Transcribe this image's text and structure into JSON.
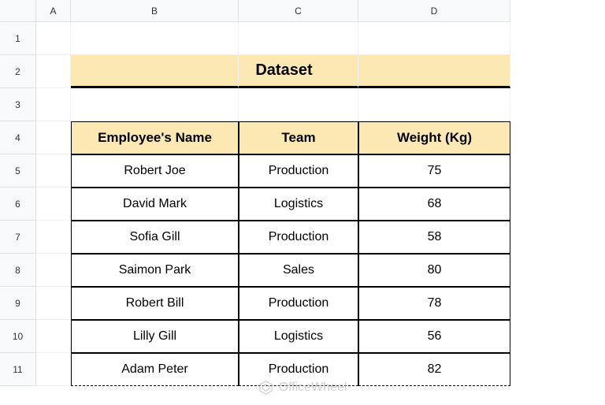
{
  "columns": [
    "A",
    "B",
    "C",
    "D"
  ],
  "rows": [
    "1",
    "2",
    "3",
    "4",
    "5",
    "6",
    "7",
    "8",
    "9",
    "10",
    "11"
  ],
  "title": "Dataset",
  "headers": {
    "name": "Employee's Name",
    "team": "Team",
    "weight": "Weight (Kg)"
  },
  "data": [
    {
      "name": "Robert Joe",
      "team": "Production",
      "weight": "75"
    },
    {
      "name": "David Mark",
      "team": "Logistics",
      "weight": "68"
    },
    {
      "name": "Sofia Gill",
      "team": "Production",
      "weight": "58"
    },
    {
      "name": "Saimon Park",
      "team": "Sales",
      "weight": "80"
    },
    {
      "name": "Robert Bill",
      "team": "Production",
      "weight": "78"
    },
    {
      "name": "Lilly Gill",
      "team": "Logistics",
      "weight": "56"
    },
    {
      "name": "Adam Peter",
      "team": "Production",
      "weight": "82"
    }
  ],
  "watermark": "OfficeWheel"
}
